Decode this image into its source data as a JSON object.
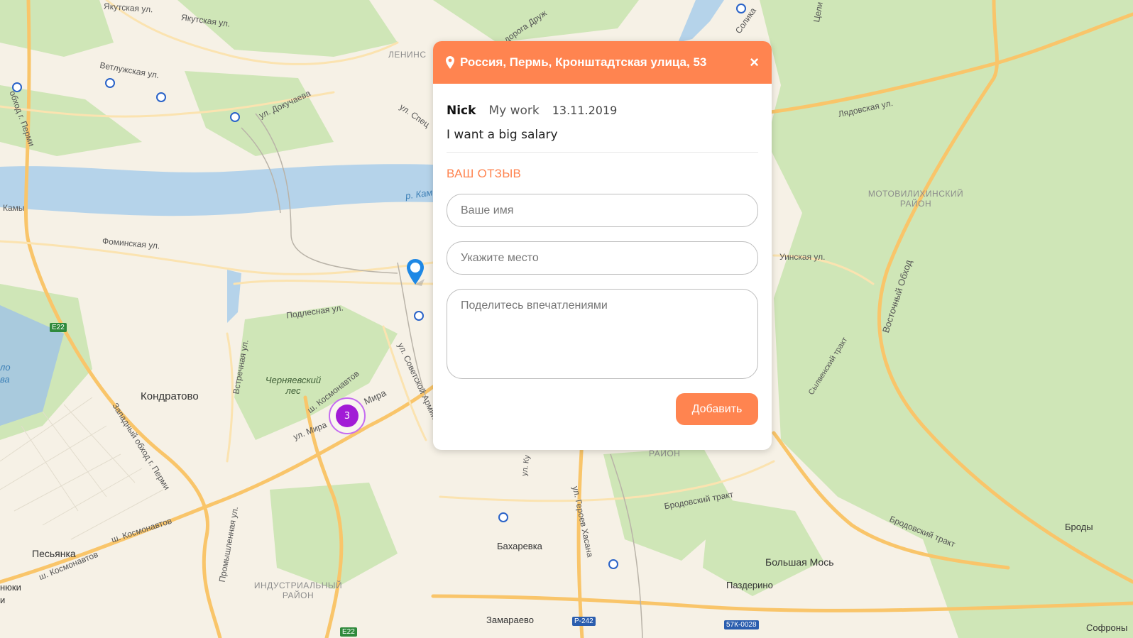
{
  "colors": {
    "accent": "#ff8450",
    "cluster": "#a21cd6",
    "pin": "#1e88e5",
    "water": "#b5d3ea",
    "forest": "#cfe6b7",
    "road_major": "#f9c56a",
    "land": "#f6f1e6"
  },
  "map": {
    "labels": {
      "yakutskaya1": "Якутская ул.",
      "yakutskaya2": "Якутская ул.",
      "vetluzhskaya": "Ветлужская ул.",
      "dokuchaeva": "ул. Докучаева",
      "spets": "ул. Спец",
      "leninsky": "ЛЕНИНС",
      "doroga": "дорога Друж",
      "solikam": "Солика",
      "tseli": "Цели",
      "obkhod_perm": "обход г. Перми",
      "kamy": "Камы",
      "r_kama": "р. Кам",
      "fominskaya": "Фоминская ул.",
      "podlesnaya": "Подлесная ул.",
      "vstrechnaya": "Встречная ул.",
      "kondratovo": "Кондратово",
      "chernyaevsky": "Черняевский лес",
      "sh_kosmonavtov": "ш. Космонавтов",
      "mira": "Мира",
      "ul_mira": "ул. Мира",
      "sov_armii": "ул. Советской Армии",
      "zapadny_obkhod": "Западный обход г. Перми",
      "lo": "ло",
      "va": "ва",
      "lyadovskaya": "Лядовская ул.",
      "motovilikha": "МОТОВИЛИХИНСКИЙ РАЙОН",
      "uinskaya": "Уинская ул.",
      "vostochny": "Восточный Обход",
      "sylvensky": "Сылвенский тракт",
      "raion": "РАЙОН",
      "ul_ku": "ул. Ку",
      "geroev": "ул. Героев Хасана",
      "brodovsky1": "Бродовский тракт",
      "brodovsky2": "Бродовский тракт",
      "brody": "Броды",
      "bakharevka": "Бахаревка",
      "bolshaya_mos": "Большая Мось",
      "pazderino": "Паздерино",
      "zamaraevo": "Замараево",
      "sofrony": "Софроны",
      "pesyanka": "Песьянка",
      "sh_kosm2": "ш. Космонавтов",
      "sh_kosm3": "ш. Космонавтов",
      "promyshlennaya": "Промышленная ул.",
      "industrialny": "ИНДУСТРИАЛЬНЫЙ РАЙОН",
      "nyuki": "нюки",
      "i": "и"
    },
    "shields": {
      "e22_top": "E22",
      "e22_bottom": "E22",
      "r242": "Р-242",
      "k57": "57К-0028"
    },
    "cluster_count": "3"
  },
  "popup": {
    "address": "Россия, Пермь, Кронштадтская улица, 53",
    "close_label": "×",
    "review": {
      "author": "Nick",
      "place": "My work",
      "date": "13.11.2019",
      "text": "I want a big salary"
    },
    "form": {
      "title": "ВАШ ОТЗЫВ",
      "name_placeholder": "Ваше имя",
      "place_placeholder": "Укажите место",
      "impressions_placeholder": "Поделитесь впечатлениями",
      "submit_label": "Добавить"
    }
  }
}
